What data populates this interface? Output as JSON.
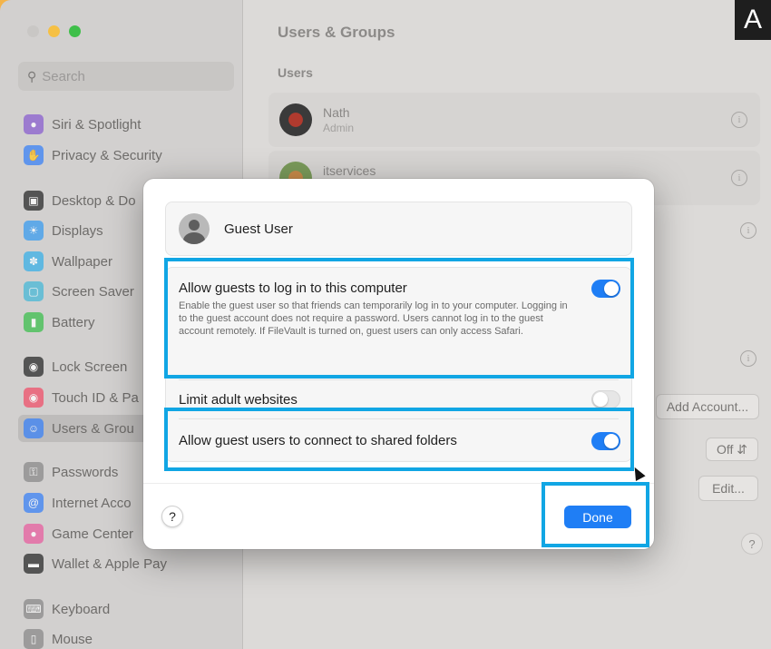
{
  "sidebar": {
    "search_placeholder": "Search",
    "items": [
      {
        "label": "Siri & Spotlight",
        "icon": "siri-icon",
        "color": "#8a5fd0"
      },
      {
        "label": "Privacy & Security",
        "icon": "hand-icon",
        "color": "#3b82f6"
      },
      {
        "label": "Desktop & Do",
        "icon": "desktop-icon",
        "color": "#2b2b2b"
      },
      {
        "label": "Displays",
        "icon": "sun-icon",
        "color": "#3b9cf0"
      },
      {
        "label": "Wallpaper",
        "icon": "flower-icon",
        "color": "#3ab0e8"
      },
      {
        "label": "Screen Saver",
        "icon": "screensaver-icon",
        "color": "#48b8d8"
      },
      {
        "label": "Battery",
        "icon": "battery-icon",
        "color": "#3dbf4e"
      },
      {
        "label": "Lock Screen",
        "icon": "lock-icon",
        "color": "#2b2b2b"
      },
      {
        "label": "Touch ID & Pa",
        "icon": "fingerprint-icon",
        "color": "#f0506a"
      },
      {
        "label": "Users & Grou",
        "icon": "users-icon",
        "color": "#3b82f6"
      },
      {
        "label": "Passwords",
        "icon": "key-icon",
        "color": "#8a8a8a"
      },
      {
        "label": "Internet Acco",
        "icon": "at-icon",
        "color": "#3b82f6"
      },
      {
        "label": "Game Center",
        "icon": "gamecenter-icon",
        "color": "#e85fa0"
      },
      {
        "label": "Wallet & Apple Pay",
        "icon": "wallet-icon",
        "color": "#2b2b2b"
      },
      {
        "label": "Keyboard",
        "icon": "keyboard-icon",
        "color": "#8a8a8a"
      },
      {
        "label": "Mouse",
        "icon": "mouse-icon",
        "color": "#8a8a8a"
      }
    ]
  },
  "main": {
    "title": "Users & Groups",
    "users_section": "Users",
    "users": [
      {
        "name": "Nath",
        "role": "Admin"
      },
      {
        "name": "itservices",
        "role": ""
      }
    ],
    "add_account": "Add Account...",
    "off_label": "Off",
    "edit_label": "Edit...",
    "help": "?"
  },
  "overlay_letter": "A",
  "sheet": {
    "guest_name": "Guest User",
    "option1": {
      "title": "Allow guests to log in to this computer",
      "desc": "Enable the guest user so that friends can temporarily log in to your computer. Logging in to the guest account does not require a password. Users cannot log in to the guest account remotely. If FileVault is turned on, guest users can only access Safari.",
      "on": true
    },
    "option2": {
      "title": "Limit adult websites",
      "on": false
    },
    "option3": {
      "title": "Allow guest users to connect to shared folders",
      "on": true
    },
    "help": "?",
    "done": "Done"
  },
  "colors": {
    "accent": "#1f7ef5",
    "highlight": "#11a6e4"
  }
}
